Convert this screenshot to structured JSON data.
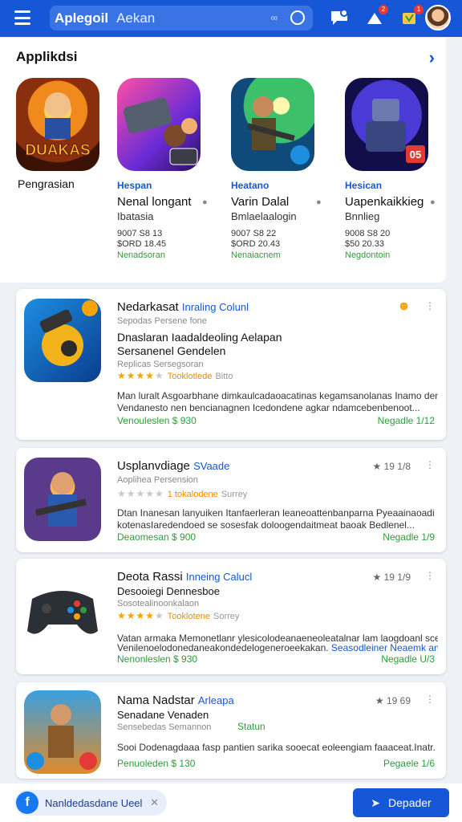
{
  "header": {
    "brand": "Aplegoil",
    "query": "Aekan",
    "search_hint": "∞",
    "badges": [
      "2",
      "1"
    ]
  },
  "featured": {
    "title": "Applikdsi",
    "apps": [
      {
        "art": "DUAKAS",
        "category": "",
        "name": "Pengrasian",
        "sub": "",
        "meta1": "",
        "meta2": "",
        "green": ""
      },
      {
        "art": "",
        "category": "Hespan",
        "name": "Nenal longant",
        "sub": "Ibatasia",
        "meta1": "9007 S8 13",
        "meta2": "$ORD 18.45",
        "green": "Nenadsoran"
      },
      {
        "art": "",
        "category": "Heatano",
        "name": "Varin Dalal",
        "sub": "Bmlaelaalogin",
        "meta1": "9007 S8 22",
        "meta2": "$ORD 20.43",
        "green": "Nenaiacnem"
      },
      {
        "art": "05",
        "category": "Hesican",
        "name": "Uapenkaikkieg",
        "sub": "Bnnlieg",
        "meta1": "9008 S8 20",
        "meta2": "$50 20.33",
        "green": "Negdontoin"
      }
    ]
  },
  "list": [
    {
      "title": "Nedarkasat",
      "tag": "Inraling Colunl",
      "developer": "Sepodas Persene fone",
      "line1": "Dnaslaran Iaadaldeoling Aelapan",
      "line2": "Sersanenel Gendelen",
      "line3": "Replicas Sersegsoran",
      "stars_text": "Tooklotlede",
      "stars_extra": "Bitto",
      "desc1": "Man luralt Asgoarbhane dimkaulcadaoacatinas kegamsanolanas Inamo den.",
      "desc2": "Vendanesto nen bencianagnen Icedondene agkar ndamcebenbenoot...",
      "price": "Venouleslen $ 930",
      "right": "Negadle 1/12"
    },
    {
      "title": "Usplanvdiage",
      "tag": "SVaade",
      "developer": "Aoplihea Persension",
      "stars_text": "1 tokalodene",
      "stars_extra": "Surrey",
      "rating": "19  1/8",
      "desc1": "Dtan Inanesan lanyuiken Itanfaerleran leaneoattenbanparna  Pyeaainaoadi",
      "desc2": "kotenasIaredendoed se sosesfak doloogendaitmeat baoak  Bedlenel...",
      "price": "Deaomesan $ 900",
      "right": "Negadle 1/9"
    },
    {
      "title": "Deota Rassi",
      "tag": "Inneing Calucl",
      "developer": "Desooiegi Dennesboe",
      "line3": "Sosotealinoonkalaon",
      "stars_text": "Tooklotene",
      "stars_extra": "Sorrey",
      "rating": "19  1/9",
      "desc1": "Vatan armaka Memonetlanr ylesicolodeanaeneoleatalnar lam  laogdoanl sceeadl",
      "desc2": "Venilenoelodonedaneakondedelogeneroeekakan.",
      "desc_blue": "Seasodleiner  Neaemk an.",
      "price": "Nenonleslen $ 930",
      "right": "Negadle U/3"
    },
    {
      "title": "Nama Nadstar",
      "tag": "Arleapa",
      "developer": "Senadane Venaden",
      "line3": "Sensebedas Semannon",
      "stars_extra": "Statun",
      "rating": "19  69",
      "desc1": "Sooi Dodenagdaaa fasp pantien sarika sooecat eoleengiam faaaceat.Inatr.",
      "price": "Penuoleden $ 130",
      "right": "Pegaele 1/6"
    }
  ],
  "bottom": {
    "chip": "Nanldedasdane  Ueel",
    "cta": "Depader"
  }
}
